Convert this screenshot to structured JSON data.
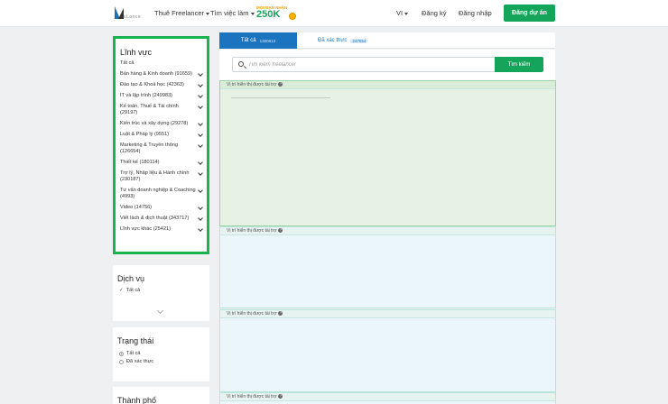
{
  "header": {
    "logo_text": "vLance",
    "nav": {
      "freelancer": "Thuê Freelancer",
      "jobs": "Tìm việc làm"
    },
    "promo": {
      "top": "MỜI BẠN NHẬN",
      "amount": "250K"
    },
    "lang": "VI",
    "register": "Đăng ký",
    "login": "Đăng nhập",
    "post_project": "Đăng dự án"
  },
  "sidebar": {
    "field": {
      "title": "Lĩnh vực",
      "items": [
        "Tất cả",
        "Bán hàng & Kinh doanh (91659)",
        "Đào tạo & Khoá học (42363)",
        "IT và lập trình (249983)",
        "Kế toán, Thuế & Tài chính (29197)",
        "Kiến trúc và xây dựng (29278)",
        "Luật & Pháp lý (9551)",
        "Marketing & Truyền thông (126654)",
        "Thiết kế (180114)",
        "Trợ lý, Nhập liệu & Hành chính (230187)",
        "Tư vấn doanh nghiệp & Coaching (4993)",
        "Video (14756)",
        "Viết lách & dịch thuật (343717)",
        "Lĩnh vực khác (25421)"
      ]
    },
    "service": {
      "title": "Dịch vụ",
      "selected": "Tất cả"
    },
    "status": {
      "title": "Trạng thái",
      "options": [
        "Tất cả",
        "Đã xác thực"
      ]
    },
    "city": {
      "title": "Thành phố"
    }
  },
  "main": {
    "tabs": {
      "all_label": "Tất cả",
      "all_count": "1300613",
      "verified_label": "Đã xác thực",
      "verified_count": "247554"
    },
    "search": {
      "placeholder": "Tìm kiếm freelancer",
      "button": "Tìm kiếm"
    },
    "ad_label": "Vị trí hiển thị được tài trợ"
  },
  "colors": {
    "brand_blue": "#1b74c0",
    "brand_green": "#15a55a",
    "highlight_border": "#19b34f"
  }
}
